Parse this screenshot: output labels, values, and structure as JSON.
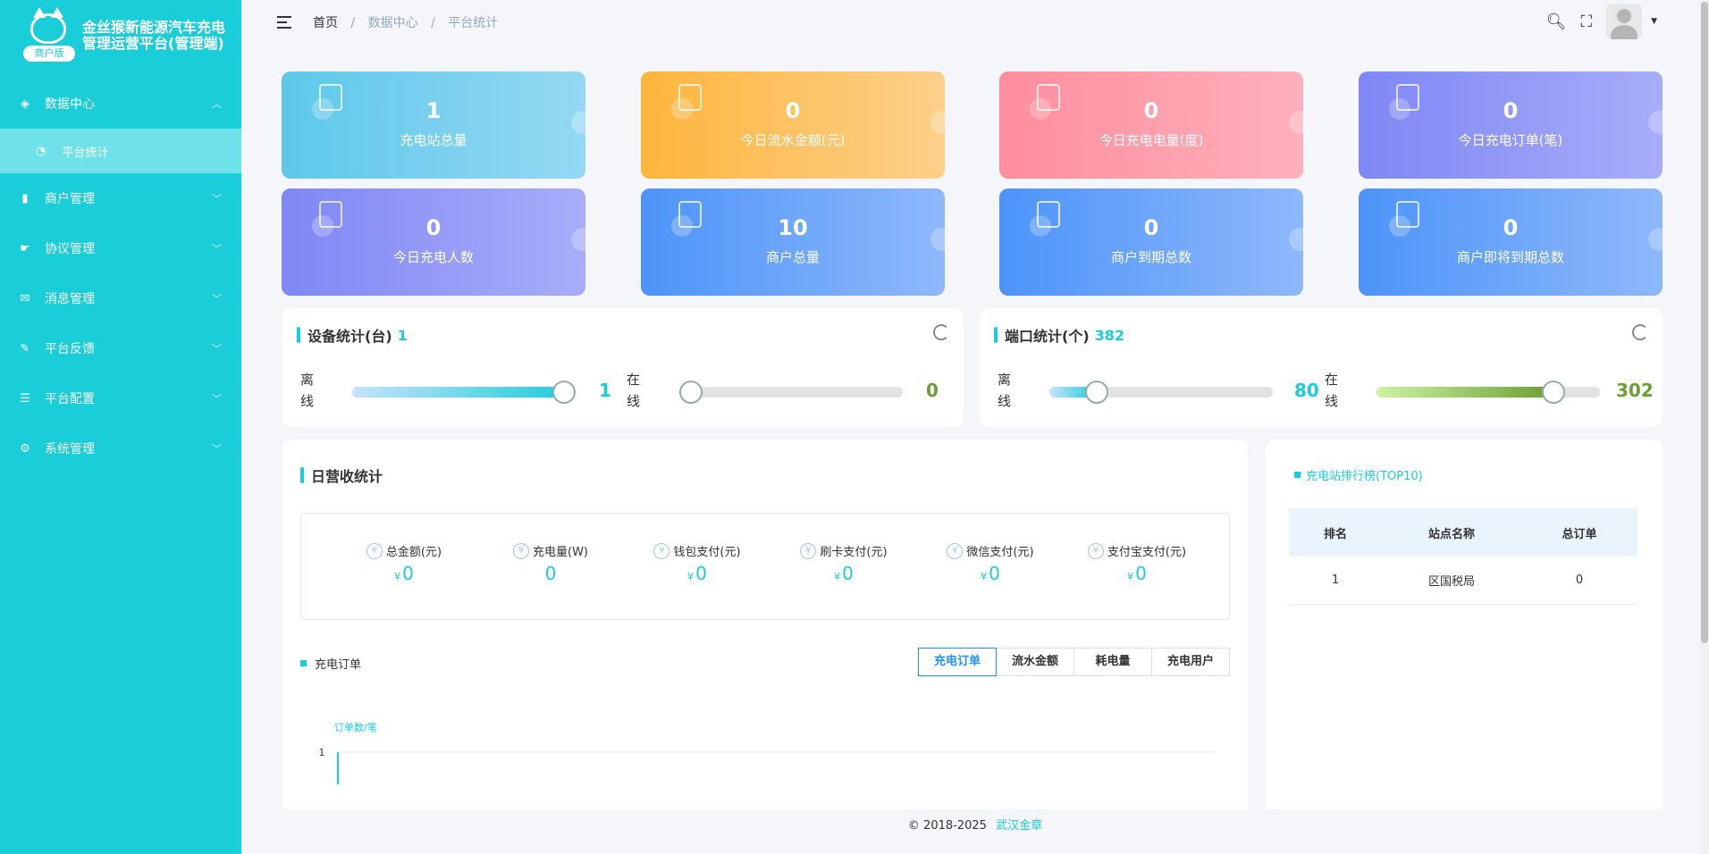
{
  "app": {
    "title": "金丝猴新能源汽车充电管理运营平台(管理端)",
    "badge": "商户版"
  },
  "sidebar": {
    "items": [
      {
        "label": "数据中心",
        "icon": "layers-icon",
        "expanded": true
      },
      {
        "label": "平台统计",
        "icon": "dashboard-icon",
        "sub": true,
        "active": true
      },
      {
        "label": "商户管理",
        "icon": "bar-chart-icon"
      },
      {
        "label": "协议管理",
        "icon": "hand-icon"
      },
      {
        "label": "消息管理",
        "icon": "mail-icon"
      },
      {
        "label": "平台反馈",
        "icon": "edit-icon"
      },
      {
        "label": "平台配置",
        "icon": "list-icon"
      },
      {
        "label": "系统管理",
        "icon": "gear-icon"
      }
    ]
  },
  "breadcrumb": {
    "home": "首页",
    "level1": "数据中心",
    "level2": "平台统计"
  },
  "stats": [
    {
      "value": "1",
      "label": "充电站总量",
      "color": "#5dc8ea"
    },
    {
      "value": "0",
      "label": "今日流水金额(元)",
      "color": "#fdb53c"
    },
    {
      "value": "0",
      "label": "今日充电电量(度)",
      "color": "#ff8d9d"
    },
    {
      "value": "0",
      "label": "今日充电订单(笔)",
      "color": "#7f87f5"
    },
    {
      "value": "0",
      "label": "今日充电人数",
      "color": "#7f87f5"
    },
    {
      "value": "10",
      "label": "商户总量",
      "color": "#4c94f9"
    },
    {
      "value": "0",
      "label": "商户到期总数",
      "color": "#4c94f9"
    },
    {
      "value": "0",
      "label": "商户即将到期总数",
      "color": "#4c94f9"
    }
  ],
  "device": {
    "title": "设备统计(台)",
    "total": "1",
    "offline_label": "离线",
    "offline_value": "1",
    "offline_fraction": 1.0,
    "online_label": "在线",
    "online_value": "0",
    "online_fraction": 0.0
  },
  "port": {
    "title": "端口统计(个)",
    "total": "382",
    "offline_label": "离线",
    "offline_value": "80",
    "offline_fraction": 0.21,
    "online_label": "在线",
    "online_value": "302",
    "online_fraction": 0.79
  },
  "daily": {
    "title": "日营收统计",
    "currency": "¥",
    "items": [
      {
        "label": "总金额(元)",
        "value": "0",
        "currency": true
      },
      {
        "label": "充电量(W)",
        "value": "0",
        "currency": false
      },
      {
        "label": "钱包支付(元)",
        "value": "0",
        "currency": true
      },
      {
        "label": "刷卡支付(元)",
        "value": "0",
        "currency": true
      },
      {
        "label": "微信支付(元)",
        "value": "0",
        "currency": true
      },
      {
        "label": "支付宝支付(元)",
        "value": "0",
        "currency": true
      }
    ]
  },
  "orders": {
    "title": "充电订单",
    "tabs": [
      "充电订单",
      "流水金额",
      "耗电量",
      "充电用户"
    ],
    "active_tab": 0
  },
  "chart_data": {
    "type": "line",
    "ylabel": "订单数/笔",
    "yticks": [
      "1"
    ],
    "ylim": [
      0,
      1
    ],
    "x": [],
    "series": []
  },
  "ranking": {
    "title": "充电站排行榜(TOP10)",
    "headers": [
      "排名",
      "站点名称",
      "总订单"
    ],
    "rows": [
      {
        "rank": "1",
        "name": "区国税局",
        "orders": "0"
      }
    ]
  },
  "footer": {
    "copyright": "© 2018-2025",
    "company": "武汉金章"
  },
  "colors": {
    "accent": "#19cdd9",
    "online_green": "#6aa031",
    "active_tab": "#1e90ff"
  }
}
